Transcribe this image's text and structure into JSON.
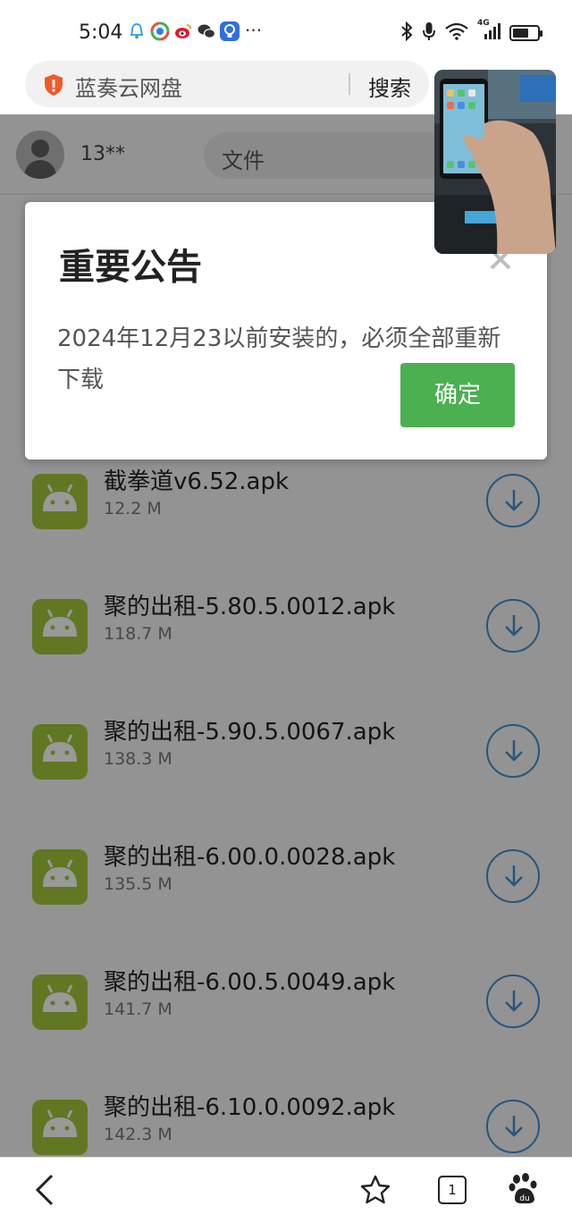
{
  "status_bar": {
    "time": "5:04",
    "network": "4G",
    "icons": [
      "bell-icon",
      "colorful-app-icon",
      "weibo-icon",
      "wechat-icon",
      "bulb-app-icon"
    ],
    "right_icons": [
      "bluetooth-icon",
      "mic-icon",
      "wifi-icon",
      "signal-icon",
      "battery-icon"
    ]
  },
  "address_bar": {
    "site_title": "蓝奏云网盘",
    "search_button": "搜索"
  },
  "header": {
    "user_name": "13**",
    "search_placeholder": "文件"
  },
  "dialog": {
    "title": "重要公告",
    "message": "2024年12月23以前安装的，必须全部重新下载",
    "confirm_label": "确定"
  },
  "files": [
    {
      "name": "截拳道v6.52.apk",
      "size": "12.2 M"
    },
    {
      "name": "聚的出租-5.80.5.0012.apk",
      "size": "118.7 M"
    },
    {
      "name": "聚的出租-5.90.5.0067.apk",
      "size": "138.3 M"
    },
    {
      "name": "聚的出租-6.00.0.0028.apk",
      "size": "135.5 M"
    },
    {
      "name": "聚的出租-6.00.5.0049.apk",
      "size": "141.7 M"
    },
    {
      "name": "聚的出租-6.10.0.0092.apk",
      "size": "142.3 M"
    }
  ],
  "bottom_nav": {
    "tab_count": "1"
  },
  "colors": {
    "confirm_green": "#4caf50",
    "android_green": "#a4c639",
    "download_blue": "#3d8fd0",
    "shield_orange": "#f05a28"
  }
}
